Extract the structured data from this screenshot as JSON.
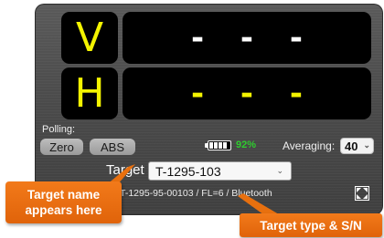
{
  "readouts": {
    "v_axis": "V",
    "v_value": "- - -",
    "h_axis": "H",
    "h_value": "- - -"
  },
  "polling": {
    "label": "Polling:",
    "zero_label": "Zero",
    "abs_label": "ABS"
  },
  "battery": {
    "percent_text": "92%",
    "level": 0.92
  },
  "averaging": {
    "label": "Averaging:",
    "value": "40"
  },
  "target": {
    "label": "Target",
    "selected": "T-1295-103",
    "info": "T-1295-95-00103 / FL=6 / Bluetooth"
  },
  "callouts": {
    "name_line1": "Target name",
    "name_line2": "appears here",
    "type": "Target type & S/N"
  },
  "colors": {
    "axis_yellow": "#f4f400",
    "value_white": "#ffffff",
    "battery_green": "#2ecc2e",
    "callout_orange": "#e8700f"
  },
  "icons": {
    "expand": "expand-arrows-icon",
    "battery": "battery-icon",
    "caret": "chevron-down-icon"
  }
}
